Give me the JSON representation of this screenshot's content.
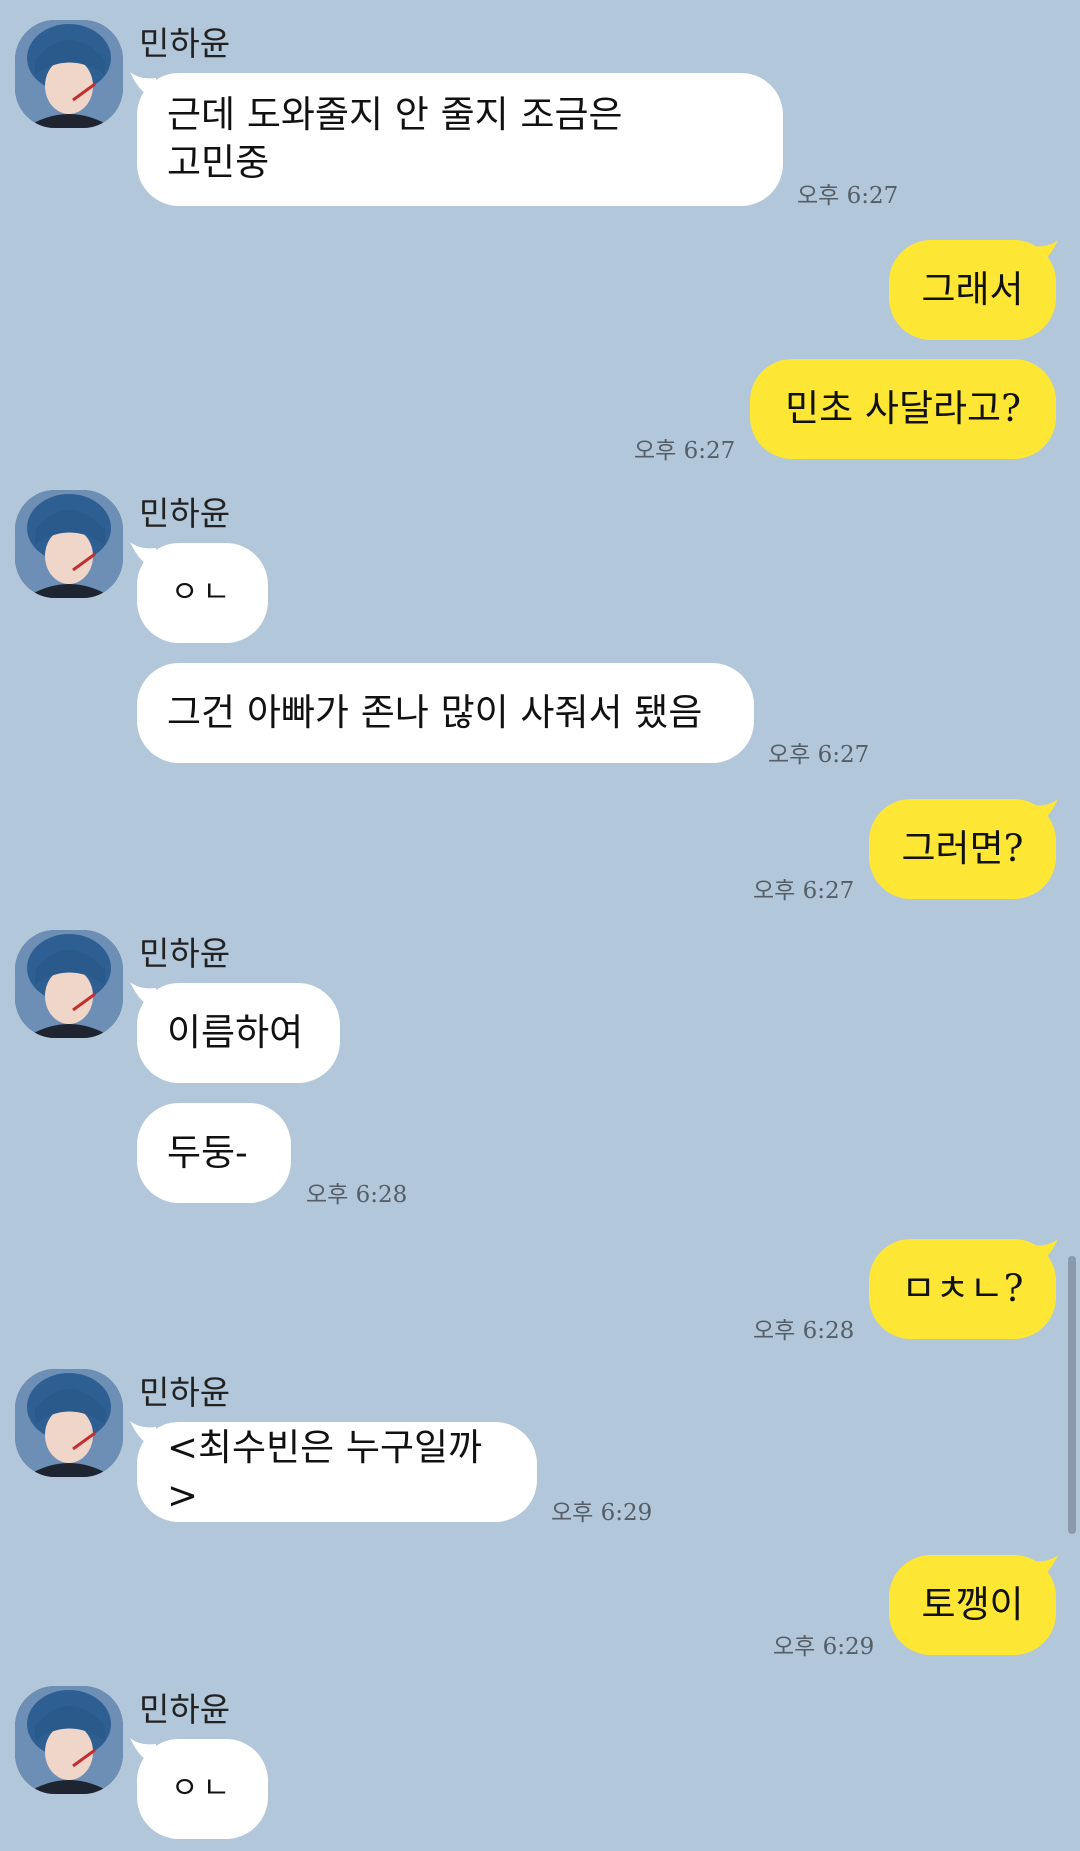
{
  "colors": {
    "background": "#b2c7da",
    "incoming_bubble": "#ffffff",
    "outgoing_bubble": "#fde734"
  },
  "sender_name": "민하윤",
  "messages": [
    {
      "name": "민하윤",
      "text_line1": "근데 도와줄지 안 줄지 조금은",
      "text_line2": "고민중",
      "time": "오후 6:27"
    },
    {
      "text": "그래서"
    },
    {
      "text": "민초 사달라고?",
      "time": "오후 6:27"
    },
    {
      "name": "민하윤",
      "text": "ㅇㄴ"
    },
    {
      "text": "그건 아빠가 존나 많이 사줘서 됐음",
      "time": "오후 6:27"
    },
    {
      "text": "그러면?",
      "time": "오후 6:27"
    },
    {
      "name": "민하윤",
      "text": "이름하여"
    },
    {
      "text": "두둥-",
      "time": "오후 6:28"
    },
    {
      "text": "ㅁㅊㄴ?",
      "time": "오후 6:28"
    },
    {
      "name": "민하윤",
      "text": "<최수빈은 누구일까>",
      "time": "오후 6:29"
    },
    {
      "text": "토깽이",
      "time": "오후 6:29"
    },
    {
      "name": "민하윤",
      "text": "ㅇㄴ"
    }
  ]
}
